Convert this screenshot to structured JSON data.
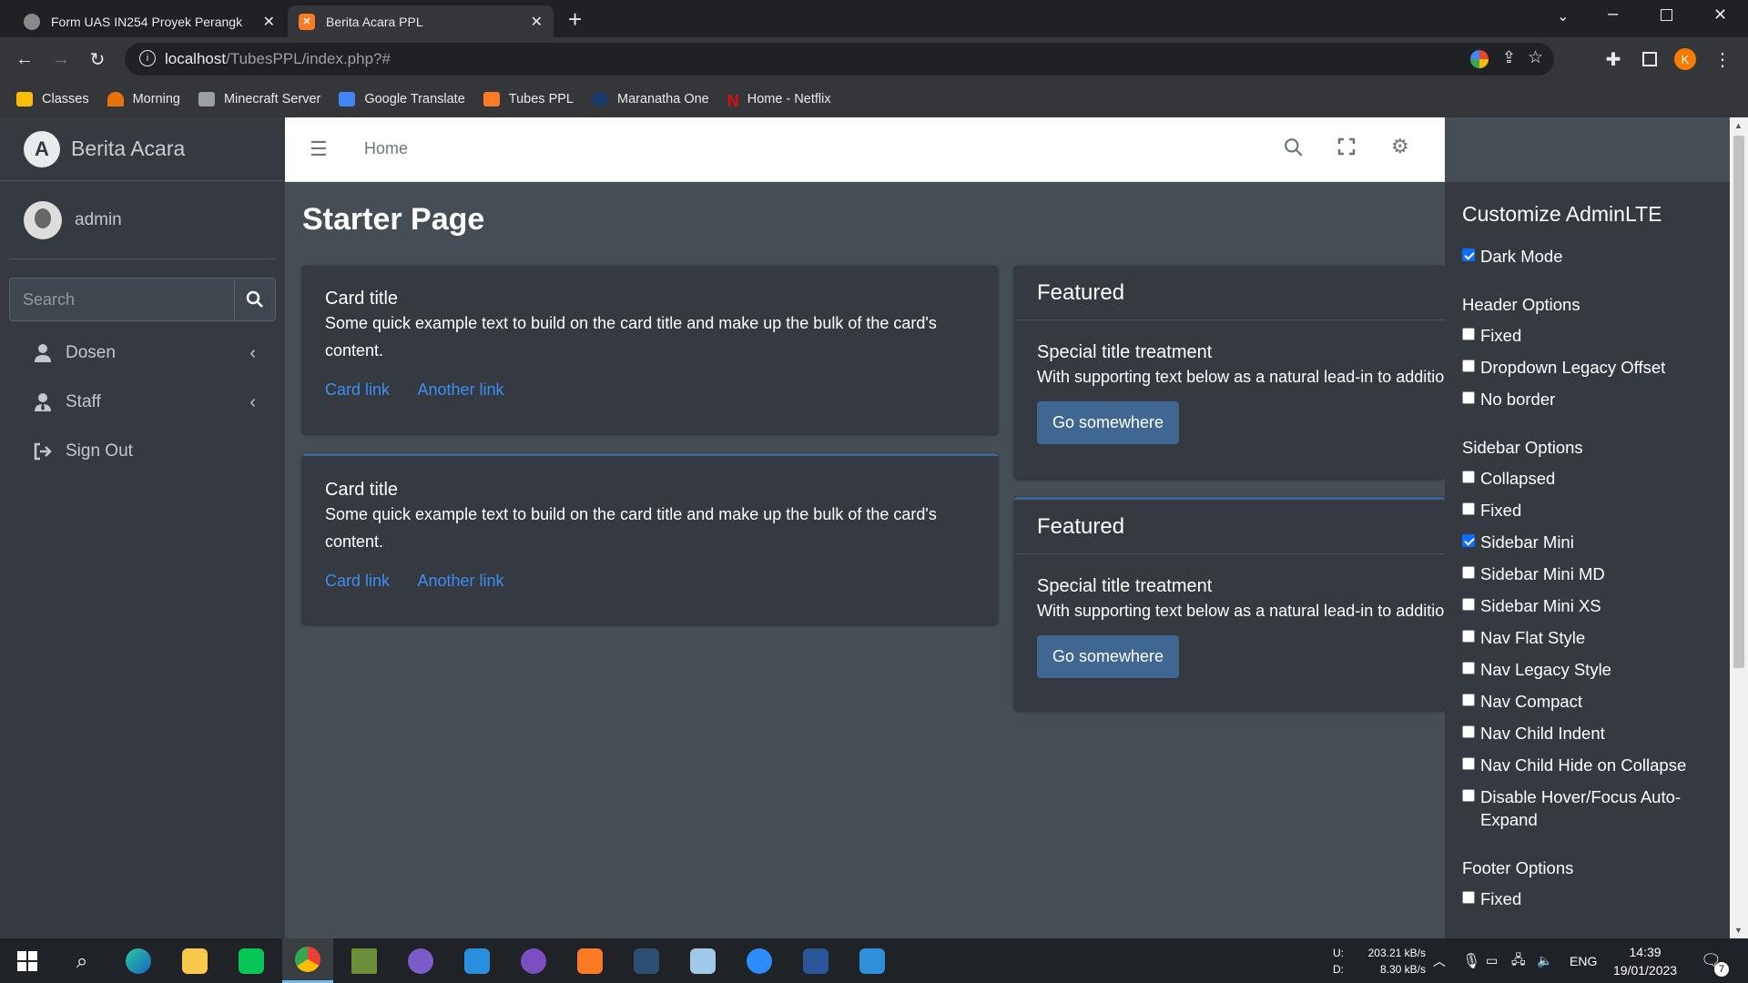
{
  "browser": {
    "tabs": [
      {
        "title": "Form UAS IN254 Proyek Perangk",
        "active": false
      },
      {
        "title": "Berita Acara PPL",
        "active": true
      }
    ],
    "url_host": "localhost",
    "url_path": "/TubesPPL/index.php?#",
    "profile_initial": "K",
    "bookmarks": [
      "Classes",
      "Morning",
      "Minecraft Server",
      "Google Translate",
      "Tubes PPL",
      "Maranatha One",
      "Home - Netflix"
    ]
  },
  "sidebar": {
    "brand": "Berita Acara",
    "brand_logo": "A",
    "user": "admin",
    "search_placeholder": "Search",
    "items": [
      {
        "label": "Dosen",
        "icon": "user-icon"
      },
      {
        "label": "Staff",
        "icon": "user-tie-icon"
      },
      {
        "label": "Sign Out",
        "icon": "sign-out-icon"
      }
    ]
  },
  "topnav": {
    "home": "Home"
  },
  "content": {
    "page_title": "Starter Page",
    "cards": [
      {
        "title": "Card title",
        "text": "Some quick example text to build on the card title and make up the bulk of the card's content.",
        "link1": "Card link",
        "link2": "Another link"
      },
      {
        "title": "Card title",
        "text": "Some quick example text to build on the card title and make up the bulk of the card's content.",
        "link1": "Card link",
        "link2": "Another link"
      }
    ],
    "featured": [
      {
        "header": "Featured",
        "title": "Special title treatment",
        "text": "With supporting text below as a natural lead-in to additional content.",
        "button": "Go somewhere"
      },
      {
        "header": "Featured",
        "title": "Special title treatment",
        "text": "With supporting text below as a natural lead-in to additional content.",
        "button": "Go somewhere"
      }
    ]
  },
  "control_sidebar": {
    "title": "Customize AdminLTE",
    "dark_mode": {
      "label": "Dark Mode",
      "checked": true
    },
    "header_heading": "Header Options",
    "header_options": [
      {
        "label": "Fixed",
        "checked": false
      },
      {
        "label": "Dropdown Legacy Offset",
        "checked": false
      },
      {
        "label": "No border",
        "checked": false
      }
    ],
    "sidebar_heading": "Sidebar Options",
    "sidebar_options": [
      {
        "label": "Collapsed",
        "checked": false
      },
      {
        "label": "Fixed",
        "checked": false
      },
      {
        "label": "Sidebar Mini",
        "checked": true
      },
      {
        "label": "Sidebar Mini MD",
        "checked": false
      },
      {
        "label": "Sidebar Mini XS",
        "checked": false
      },
      {
        "label": "Nav Flat Style",
        "checked": false
      },
      {
        "label": "Nav Legacy Style",
        "checked": false
      },
      {
        "label": "Nav Compact",
        "checked": false
      },
      {
        "label": "Nav Child Indent",
        "checked": false
      },
      {
        "label": "Nav Child Hide on Collapse",
        "checked": false
      },
      {
        "label": "Disable Hover/Focus Auto-Expand",
        "checked": false
      }
    ],
    "footer_heading": "Footer Options",
    "footer_options": [
      {
        "label": "Fixed",
        "checked": false
      }
    ]
  },
  "taskbar": {
    "upload": "203.21 kB/s",
    "download": "8.30 kB/s",
    "up_label": "U:",
    "down_label": "D:",
    "lang": "ENG",
    "time": "14:39",
    "date": "19/01/2023",
    "notif_count": "7"
  },
  "colors": {
    "accent": "#3f6791",
    "link": "#3f8cf2",
    "sidebar": "#343a40",
    "content_bg": "#454d55"
  }
}
